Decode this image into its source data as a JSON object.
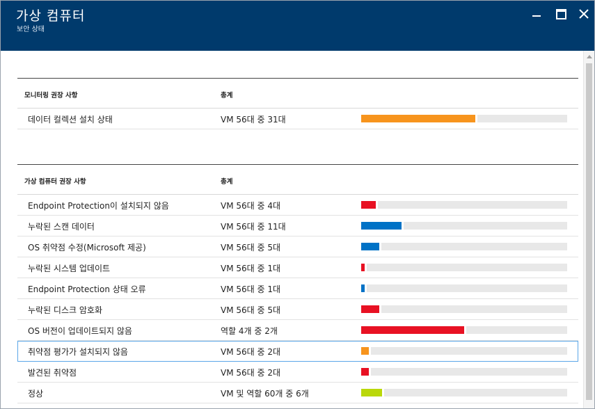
{
  "window": {
    "title": "가상 컴퓨터",
    "subtitle": "보안 상태"
  },
  "monitoring": {
    "header_name": "모니터링 권장 사항",
    "header_total": "총계",
    "rows": [
      {
        "name": "데이터 컬렉션 설치 상태",
        "total": "VM 56대 중 31대",
        "progress": 0.553,
        "color": "#f7941d"
      }
    ]
  },
  "vm_recommendations": {
    "header_name": "가상 컴퓨터 권장 사항",
    "header_total": "총계",
    "rows": [
      {
        "name": "Endpoint Protection이 설치되지 않음",
        "total": "VM 56대 중 4대",
        "progress": 0.071,
        "color": "#e81123"
      },
      {
        "name": "누락된 스캔 데이터",
        "total": "VM 56대 중 11대",
        "progress": 0.196,
        "color": "#0072c6"
      },
      {
        "name": "OS 취약점 수정(Microsoft 제공)",
        "total": "VM 56대 중 5대",
        "progress": 0.089,
        "color": "#0072c6"
      },
      {
        "name": "누락된 시스템 업데이트",
        "total": "VM 56대 중 1대",
        "progress": 0.018,
        "color": "#e81123"
      },
      {
        "name": "Endpoint Protection 상태 오류",
        "total": "VM 56대 중 1대",
        "progress": 0.018,
        "color": "#0072c6"
      },
      {
        "name": "누락된 디스크 암호화",
        "total": "VM 56대 중 5대",
        "progress": 0.089,
        "color": "#e81123"
      },
      {
        "name": "OS 버전이 업데이트되지 않음",
        "total": "역할 4개 중 2개",
        "progress": 0.5,
        "color": "#e81123"
      },
      {
        "name": "취약점 평가가 설치되지 않음",
        "total": "VM 56대 중 2대",
        "progress": 0.036,
        "color": "#f7941d",
        "selected": true
      },
      {
        "name": "발견된 취약점",
        "total": "VM 56대 중 2대",
        "progress": 0.036,
        "color": "#e81123"
      },
      {
        "name": "정상",
        "total": "VM 및 역할 60개 중 6개",
        "progress": 0.1,
        "color": "#bad80a"
      }
    ]
  }
}
